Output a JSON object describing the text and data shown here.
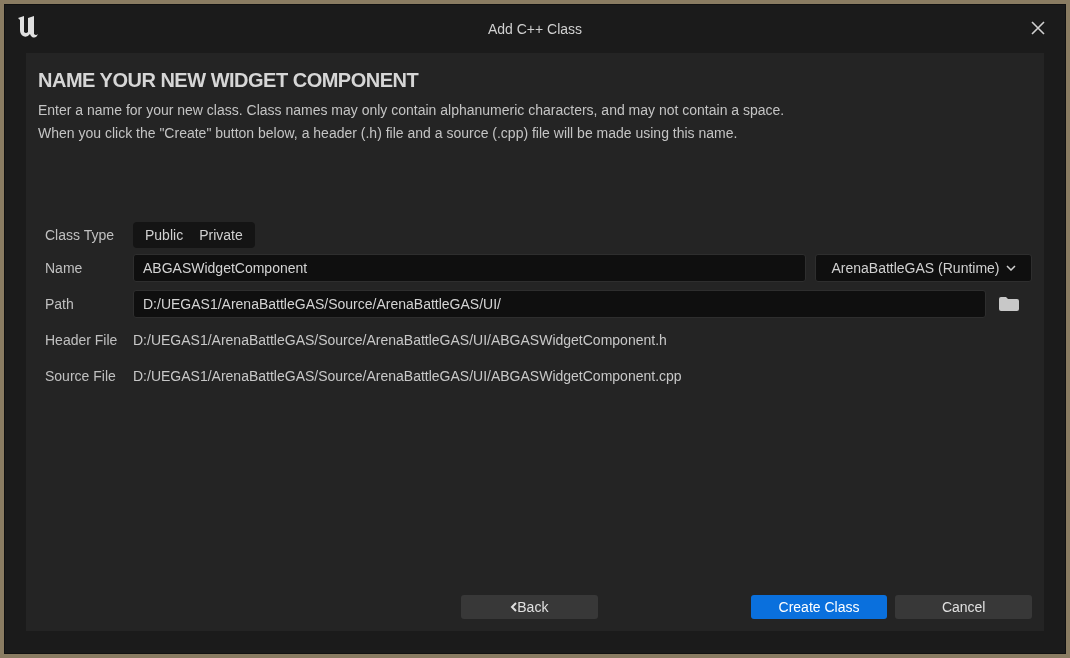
{
  "window": {
    "title": "Add C++ Class"
  },
  "heading": "NAME YOUR NEW WIDGET COMPONENT",
  "description": [
    "Enter a name for your new class. Class names may only contain alphanumeric characters, and may not contain a space.",
    "When you click the \"Create\" button below, a header (.h) file and a source (.cpp) file will be made using this name."
  ],
  "class_type": {
    "label": "Class Type",
    "options": [
      {
        "label": "Public",
        "selected": false
      },
      {
        "label": "Private",
        "selected": false
      }
    ]
  },
  "name": {
    "label": "Name",
    "value": "ABGASWidgetComponent",
    "module": "ArenaBattleGAS (Runtime)"
  },
  "path": {
    "label": "Path",
    "value": "D:/UEGAS1/ArenaBattleGAS/Source/ArenaBattleGAS/UI/"
  },
  "header_file": {
    "label": "Header File",
    "value": "D:/UEGAS1/ArenaBattleGAS/Source/ArenaBattleGAS/UI/ABGASWidgetComponent.h"
  },
  "source_file": {
    "label": "Source File",
    "value": "D:/UEGAS1/ArenaBattleGAS/Source/ArenaBattleGAS/UI/ABGASWidgetComponent.cpp"
  },
  "buttons": {
    "back": "Back",
    "create": "Create Class",
    "cancel": "Cancel"
  }
}
